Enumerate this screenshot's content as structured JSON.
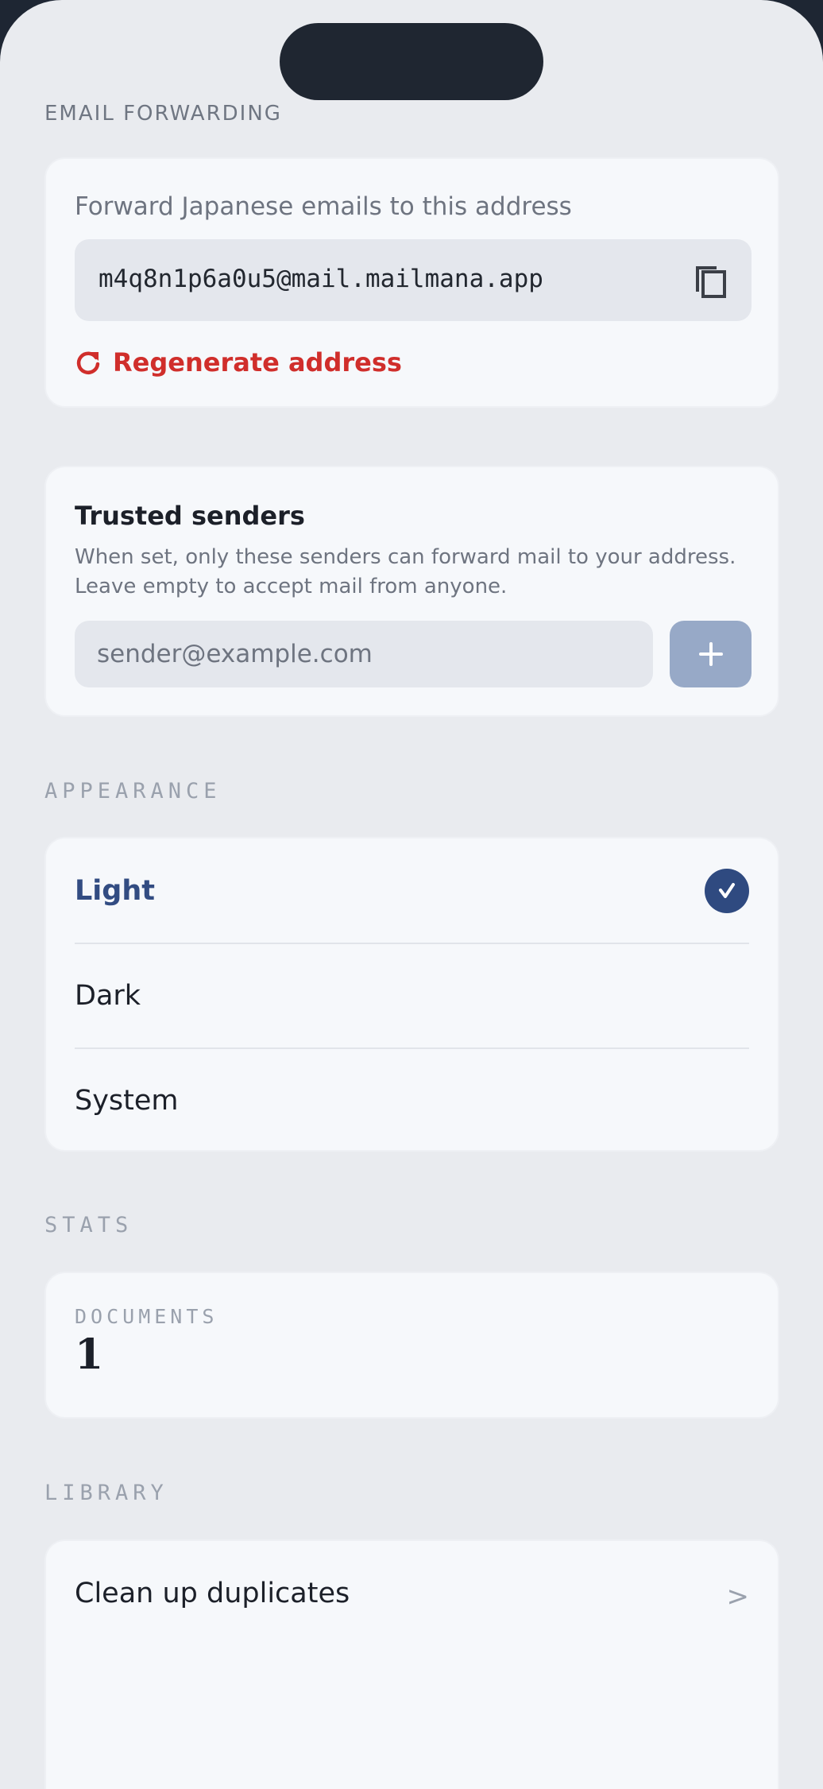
{
  "email_forwarding": {
    "section_label": "EMAIL FORWARDING",
    "subtitle": "Forward Japanese emails to this address",
    "address": "m4q8n1p6a0u5@mail.mailmana.app",
    "regenerate_label": "Regenerate address",
    "copy_icon": "copy-icon",
    "regenerate_icon": "refresh-icon"
  },
  "trusted_senders": {
    "title": "Trusted senders",
    "description": "When set, only these senders can forward mail to your address. Leave empty to accept mail from anyone.",
    "input_placeholder": "sender@example.com",
    "input_value": "",
    "add_icon": "plus-icon"
  },
  "appearance": {
    "section_label": "APPEARANCE",
    "options": [
      {
        "label": "Light",
        "selected": true
      },
      {
        "label": "Dark",
        "selected": false
      },
      {
        "label": "System",
        "selected": false
      }
    ],
    "selected_icon": "checkmark-icon"
  },
  "stats": {
    "section_label": "STATS",
    "documents_label": "DOCUMENTS",
    "documents_value": "1"
  },
  "library": {
    "section_label": "LIBRARY",
    "items": [
      {
        "label": "Clean up duplicates",
        "chevron": ">"
      }
    ]
  },
  "colors": {
    "accent": "#2f4a80",
    "danger": "#d02e2b",
    "background": "#e9ebef",
    "card": "#f6f8fb"
  }
}
